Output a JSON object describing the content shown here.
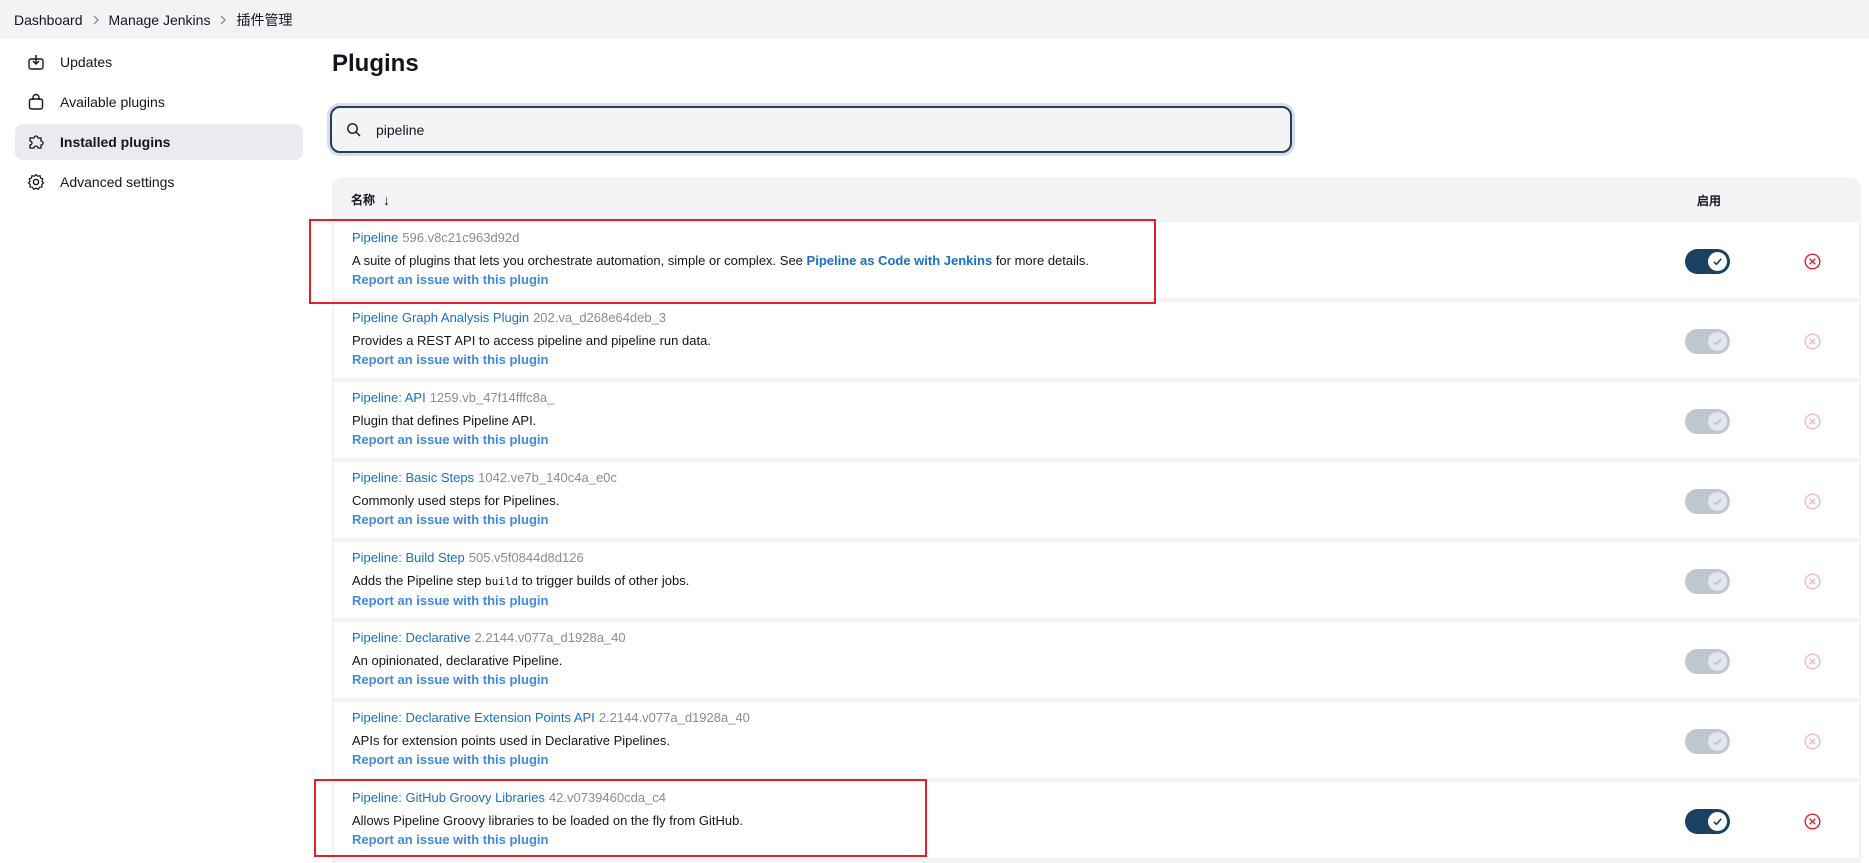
{
  "breadcrumb": [
    "Dashboard",
    "Manage Jenkins",
    "插件管理"
  ],
  "sidebar": {
    "items": [
      {
        "label": "Updates",
        "icon": "download-icon"
      },
      {
        "label": "Available plugins",
        "icon": "shopping-bag-icon"
      },
      {
        "label": "Installed plugins",
        "icon": "puzzle-icon"
      },
      {
        "label": "Advanced settings",
        "icon": "gear-icon"
      }
    ],
    "active_index": 2
  },
  "page": {
    "title": "Plugins"
  },
  "search": {
    "value": "pipeline",
    "placeholder": ""
  },
  "table": {
    "col_name": "名称",
    "sort_glyph": "↓",
    "col_enabled": "启用",
    "report_label": "Report an issue with this plugin",
    "rows": [
      {
        "name": "Pipeline",
        "version": "596.v8c21c963d92d",
        "desc_a": "A suite of plugins that lets you orchestrate automation, simple or complex. See ",
        "desc_link": "Pipeline as Code with Jenkins",
        "desc_b": " for more details.",
        "enabled": true
      },
      {
        "name": "Pipeline Graph Analysis Plugin",
        "version": "202.va_d268e64deb_3",
        "desc_a": "Provides a REST API to access pipeline and pipeline run data.",
        "enabled": false
      },
      {
        "name": "Pipeline: API",
        "version": "1259.vb_47f14fffc8a_",
        "desc_a": "Plugin that defines Pipeline API.",
        "enabled": false
      },
      {
        "name": "Pipeline: Basic Steps",
        "version": "1042.ve7b_140c4a_e0c",
        "desc_a": "Commonly used steps for Pipelines.",
        "enabled": false
      },
      {
        "name": "Pipeline: Build Step",
        "version": "505.v5f0844d8d126",
        "desc_a": "Adds the Pipeline step ",
        "desc_code": "build",
        "desc_b": " to trigger builds of other jobs.",
        "enabled": false
      },
      {
        "name": "Pipeline: Declarative",
        "version": "2.2144.v077a_d1928a_40",
        "desc_a": "An opinionated, declarative Pipeline.",
        "enabled": false
      },
      {
        "name": "Pipeline: Declarative Extension Points API",
        "version": "2.2144.v077a_d1928a_40",
        "desc_a": "APIs for extension points used in Declarative Pipelines.",
        "enabled": false
      },
      {
        "name": "Pipeline: GitHub Groovy Libraries",
        "version": "42.v0739460cda_c4",
        "desc_a": "Allows Pipeline Groovy libraries to be loaded on the fly from GitHub.",
        "enabled": true
      }
    ]
  },
  "colors": {
    "accent": "#1a6fc4",
    "toggle_on": "#1b4162",
    "uninstall": "#e0212b",
    "annotation": "#e0212b"
  }
}
